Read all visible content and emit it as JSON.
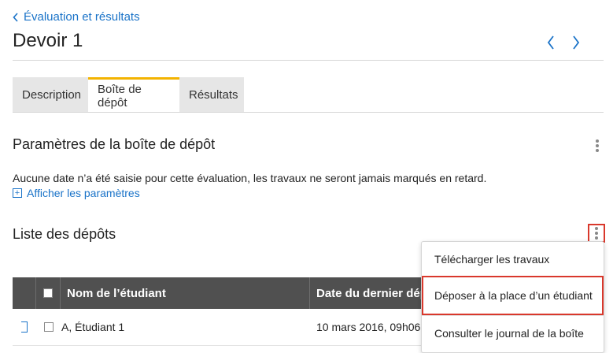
{
  "breadcrumb": {
    "label": "Évaluation et résultats"
  },
  "page": {
    "title": "Devoir 1"
  },
  "tabs": [
    {
      "label": "Description"
    },
    {
      "label": "Boîte de dépôt"
    },
    {
      "label": "Résultats"
    }
  ],
  "settings_section": {
    "title": "Paramètres de la boîte de dépôt",
    "notice": "Aucune date n’a été saisie pour cette évaluation, les travaux ne seront jamais marqués en retard.",
    "show_settings_label": "Afficher les paramètres"
  },
  "submissions_section": {
    "title": "Liste des dépôts"
  },
  "table": {
    "columns": [
      "Nom de l’étudiant",
      "Date du dernier dépô"
    ],
    "rows": [
      {
        "student": "A, Étudiant 1",
        "last_submission": "10 mars 2016, 09h06"
      }
    ]
  },
  "menu": {
    "items": [
      {
        "label": "Télécharger les travaux"
      },
      {
        "label": "Déposer à la place d’un étudiant"
      },
      {
        "label": "Consulter le journal de la boîte"
      }
    ]
  },
  "colors": {
    "link": "#1a73c8",
    "tab_accent": "#f3b300",
    "highlight": "#d9382c",
    "table_header": "#505050"
  },
  "icons": [
    "chevron-left-icon",
    "chevron-right-icon",
    "kebab-menu-icon",
    "plus-box-icon",
    "expand-icon"
  ]
}
